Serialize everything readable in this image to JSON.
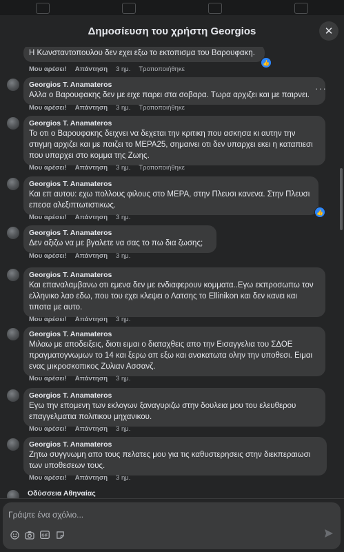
{
  "header": {
    "title": "Δημοσίευση του χρήστη Georgios"
  },
  "actions": {
    "like": "Μου αρέσει!",
    "reply": "Απάντηση",
    "time": "3 ημ.",
    "edited": "Τροποποιήθηκε"
  },
  "comments": [
    {
      "author": "",
      "text": "Η Κωνσταντοπουλου δεν εχει εξω το εκτοπισμα του Βαρουφακη."
    },
    {
      "author": "Georgios T. Anamateros",
      "text": "Αλλα ο Βαρουφακης δεν με ειχε παρει στα σοβαρα. Τωρα αρχιζει και με παιρνει."
    },
    {
      "author": "Georgios T. Anamateros",
      "text": "Το οτι ο Βαρουφακης δειχνει να δεχεται την κριτικη που ασκησα κι αυτην την στιγμη αρχιζει και με παιζει το ΜΕΡΑ25, σημαινει οτι δεν υπαρχει εκει η καταπιεσι που υπαρχει στο κομμα της Ζωης."
    },
    {
      "author": "Georgios T. Anamateros",
      "text": "Και επ αυτου: εχω πολλους φιλους στο ΜΕΡΑ, στην Πλευσι κανενα. Στην Πλευσι επεσα αλεξιπτωτιστικως."
    },
    {
      "author": "Georgios T. Anamateros",
      "text": "Δεν αξιζω να με βγαλετε να σας το πω δια ζωσης;"
    },
    {
      "author": "Georgios T. Anamateros",
      "text": "Και επαναλαμβανω οτι εμενα δεν με ενδιαφερουν κομματα..Εγω εκπροσωπω τον ελληνικο λαο εδω, που του εχει κλεψει ο Λατσης το Ellinikon και δεν κανει και τιποτα με αυτο."
    },
    {
      "author": "Georgios T. Anamateros",
      "text": "Μιλαω με αποδειξεις, διοτι ειμαι ο διαταχθεις απο την Εισαγγελια του ΣΔΟΕ πραγματογνωμων το 14 και ξερω απ εξω και ανακατωτα ολην την υποθεσι. Ειμαι ενας μικροσκοπικος Ζυλιαν Ασσανζ."
    },
    {
      "author": "Georgios T. Anamateros",
      "text": "Εγω την επομενη των εκλογων ξαναγυριζω στην δουλεια μου του ελευθερου επαγγελματια πολιτικου μηχανικου."
    },
    {
      "author": "Georgios T. Anamateros",
      "text": "Ζητω συγγνωμη απο τους πελατες μου για τις καθυστερησεις στην διεκπεραιωσι των υποθεσεων τους."
    }
  ],
  "partial_author": "Οδύσσεια Αθηναίας",
  "composer": {
    "placeholder": "Γράψτε ένα σχόλιο..."
  },
  "colors": {
    "background": "#242526",
    "bubble": "#3a3b3c",
    "accent": "#2d88ff",
    "text": "#e4e6eb",
    "muted": "#b0b3b8"
  }
}
